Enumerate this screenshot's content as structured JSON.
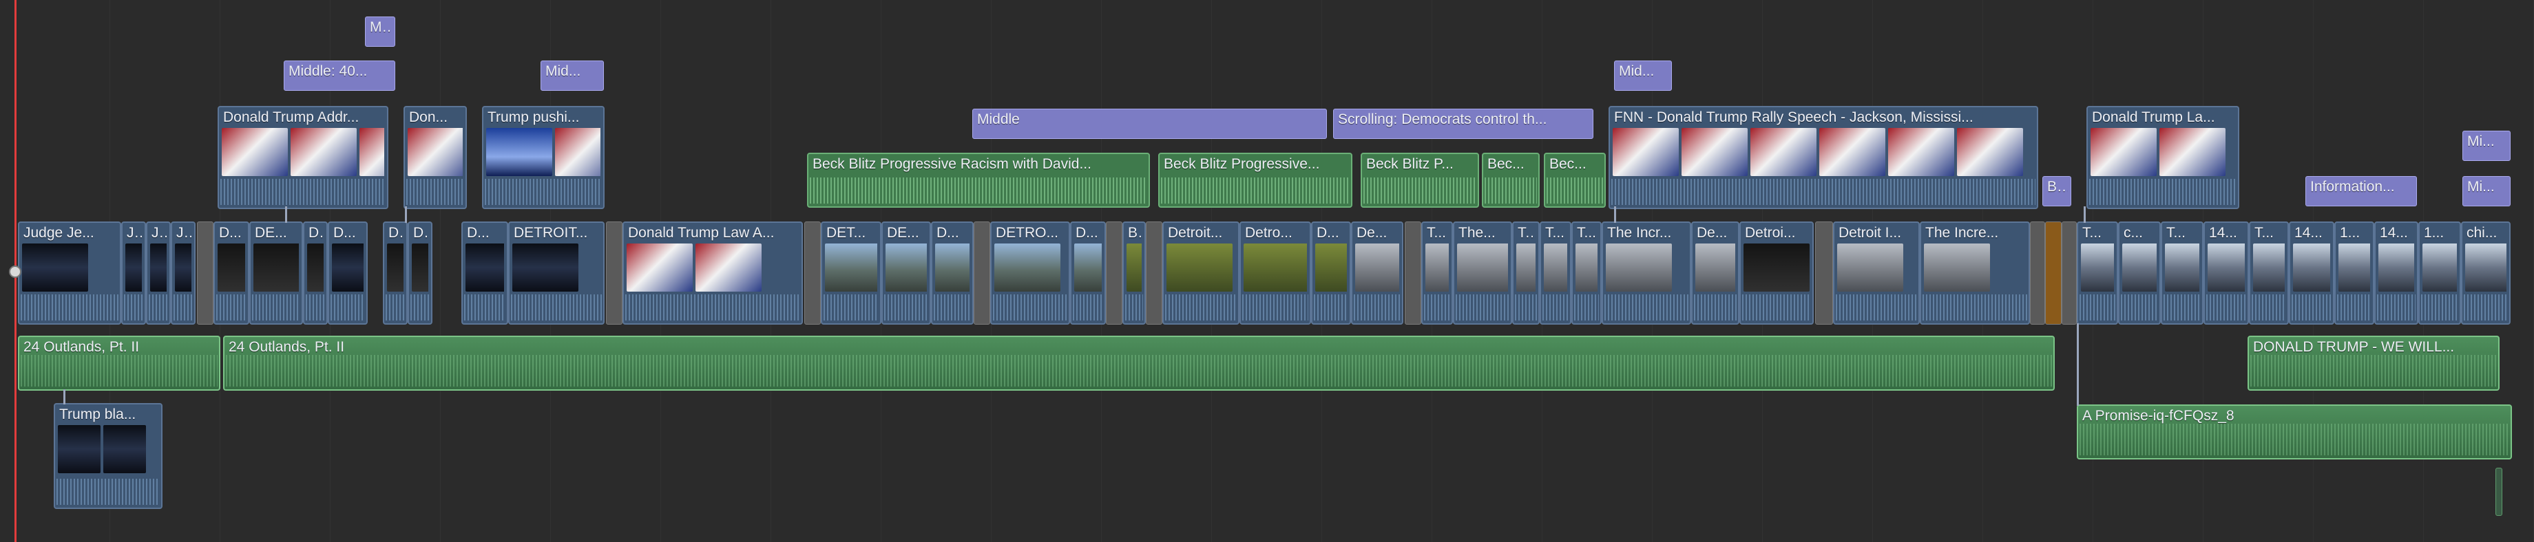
{
  "timeline": {
    "title_clips": [
      {
        "label": "M...",
        "thumb": false
      },
      {
        "label": "Middle: 40...",
        "thumb": false
      },
      {
        "label": "Mid...",
        "thumb": false
      },
      {
        "label": "Middle",
        "thumb": false
      },
      {
        "label": "Scrolling: Democrats control th...",
        "thumb": false
      },
      {
        "label": "Mid...",
        "thumb": false
      },
      {
        "label": "B...",
        "thumb": false
      },
      {
        "label": "Information...",
        "thumb": false
      },
      {
        "label": "Mi...",
        "thumb": false
      },
      {
        "label": "Mi...",
        "thumb": false
      }
    ],
    "connected_video_clips": [
      {
        "label": "Donald Trump Addr..."
      },
      {
        "label": "Don..."
      },
      {
        "label": "Trump pushi..."
      },
      {
        "label": "FNN - Donald Trump Rally Speech - Jackson, Mississi..."
      },
      {
        "label": "Donald Trump La..."
      }
    ],
    "connected_audio_clips": [
      {
        "label": "Beck Blitz Progressive Racism with David..."
      },
      {
        "label": "Beck Blitz Progressive..."
      },
      {
        "label": "Beck Blitz P..."
      },
      {
        "label": "Bec..."
      },
      {
        "label": "Bec..."
      }
    ],
    "primary_clips": [
      {
        "label": "Judge Je..."
      },
      {
        "label": "J..."
      },
      {
        "label": "J..."
      },
      {
        "label": "J..."
      },
      {
        "label": "D..."
      },
      {
        "label": "DE..."
      },
      {
        "label": "D..."
      },
      {
        "label": "D..."
      },
      {
        "label": "D..."
      },
      {
        "label": "D..."
      },
      {
        "label": "DETROIT..."
      },
      {
        "label": "Donald Trump Law A..."
      },
      {
        "label": "DET..."
      },
      {
        "label": "DE..."
      },
      {
        "label": "D..."
      },
      {
        "label": "DETRO..."
      },
      {
        "label": "D..."
      },
      {
        "label": "B..."
      },
      {
        "label": "Detroit..."
      },
      {
        "label": "Detro..."
      },
      {
        "label": "D..."
      },
      {
        "label": "De..."
      },
      {
        "label": "T..."
      },
      {
        "label": "The..."
      },
      {
        "label": "T..."
      },
      {
        "label": "T..."
      },
      {
        "label": "The Incr..."
      },
      {
        "label": "De..."
      },
      {
        "label": "Detroi..."
      },
      {
        "label": "Detroit I..."
      },
      {
        "label": "The Incre..."
      },
      {
        "label": "T..."
      },
      {
        "label": "c..."
      },
      {
        "label": "T..."
      },
      {
        "label": "14..."
      },
      {
        "label": "T..."
      },
      {
        "label": "14..."
      },
      {
        "label": "1..."
      },
      {
        "label": "14..."
      },
      {
        "label": "1..."
      },
      {
        "label": "chi..."
      }
    ],
    "audio_clips": [
      {
        "label": "24 Outlands, Pt. II"
      },
      {
        "label": "24 Outlands, Pt. II"
      },
      {
        "label": "DONALD TRUMP - WE WILL..."
      },
      {
        "label": "A Promise-iq-fCFQsz_8"
      }
    ],
    "lower_clips": [
      {
        "label": "Trump bla..."
      }
    ]
  },
  "colors": {
    "title": "#7c7cc4",
    "video": "#3d5572",
    "audio": "#3f7a4c",
    "playhead": "#e23c3c"
  }
}
